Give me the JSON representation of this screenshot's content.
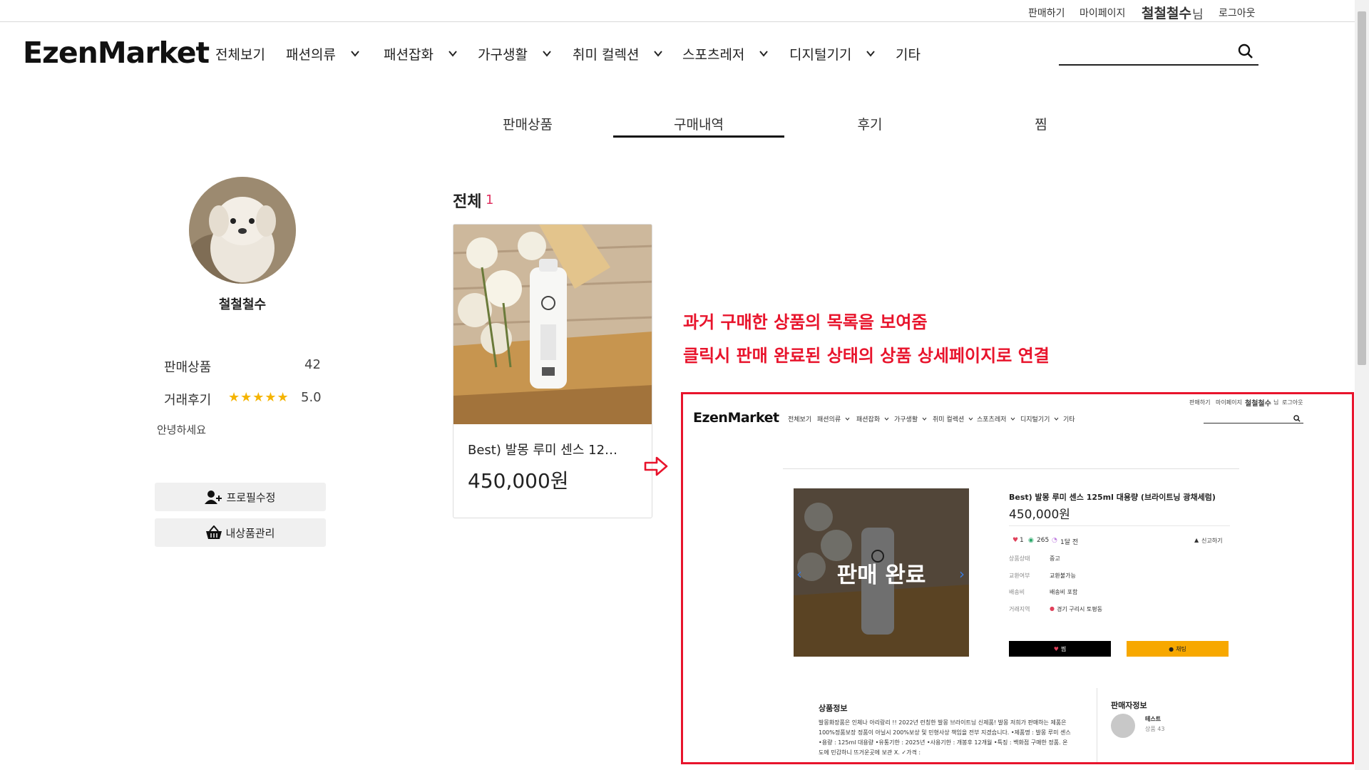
{
  "header": {
    "util_links": [
      "판매하기",
      "마이페이지"
    ],
    "user_name": "철철철수",
    "user_suffix": "님",
    "logout": "로그아웃",
    "logo_text": "EzenMarket",
    "nav": [
      {
        "label": "전체보기",
        "has_dropdown": false
      },
      {
        "label": "패션의류",
        "has_dropdown": true
      },
      {
        "label": "패션잡화",
        "has_dropdown": true
      },
      {
        "label": "가구생활",
        "has_dropdown": true
      },
      {
        "label": "취미 컬렉션",
        "has_dropdown": true
      },
      {
        "label": "스포츠레저",
        "has_dropdown": true
      },
      {
        "label": "디지털기기",
        "has_dropdown": true
      },
      {
        "label": "기타",
        "has_dropdown": false
      }
    ],
    "search_placeholder": ""
  },
  "tabs": [
    {
      "label": "판매상품",
      "active": false
    },
    {
      "label": "구매내역",
      "active": true
    },
    {
      "label": "후기",
      "active": false
    },
    {
      "label": "찜",
      "active": false
    }
  ],
  "profile": {
    "name": "철철철수",
    "sales_label": "판매상품",
    "sales_count": "42",
    "review_label": "거래후기",
    "rating": "5.0",
    "stars": 5,
    "intro": "안녕하세요",
    "edit_button": "프로필수정",
    "manage_button": "내상품관리"
  },
  "purchases": {
    "title": "전체",
    "count": "1",
    "items": [
      {
        "name": "Best) 발몽 루미 센스 125ml 대용량 (브라이트닝 광채세럼)",
        "name_display": "Best) 발몽 루미 센스 12…",
        "price": "450,000원"
      }
    ]
  },
  "annotation": {
    "line1": "과거 구매한 상품의 목록을 보여줌",
    "line2": "클릭시 판매 완료된 상태의 상품 상세페이지로 연결",
    "accent": "#e8142c"
  },
  "detail_preview": {
    "util_links": [
      "판매하기",
      "마이페이지"
    ],
    "user_name": "철철철수",
    "user_suffix": "님",
    "logout": "로그아웃",
    "logo_text": "EzenMarket",
    "nav": [
      "전체보기",
      "패션의류",
      "패션잡화",
      "가구생활",
      "취미 컬렉션",
      "스포츠레저",
      "디지털기기",
      "기타"
    ],
    "sold_label": "판매 완료",
    "title": "Best) 발몽 루미 센스 125ml 대용량 (브라이트닝 광채세럼)",
    "price": "450,000원",
    "likes": "1",
    "views": "265",
    "time_ago": "1달 전",
    "report": "신고하기",
    "specs": [
      {
        "key": "상품상태",
        "value": "중고"
      },
      {
        "key": "교환여부",
        "value": "교환불가능"
      },
      {
        "key": "배송비",
        "value": "배송비 포함"
      },
      {
        "key": "거래지역",
        "value": "경기 구리시 토평동"
      }
    ],
    "wish_button": "찜",
    "chat_button": "채팅",
    "info_title": "상품정보",
    "info_text": "발몽화장품은 인체나 아리랑리 !! 2022년 런칭한 발몽 브라이트닝 신제품! 발몽 저희가 판매하는 제품은 100%정품보장 정품이 아닐시 200%보상 및 민형사상 책임을 전부 지겠습니다. •제품명 : 발몽 루미 센스 •용량 : 125ml 대용량 •유통기한 : 2025년 •사용기한 : 개봉후 12개월 •특징 : 백화점 구매한 정품. 온도에 민감하니 뜨거운곳에 보관 X. ✓가격 :",
    "seller_title": "판매자정보",
    "seller_name": "테스트",
    "seller_items": "상품 43"
  }
}
